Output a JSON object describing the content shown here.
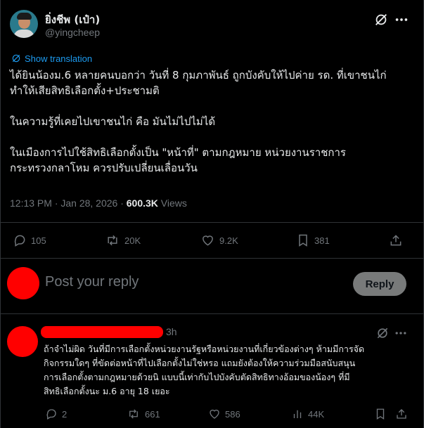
{
  "post": {
    "display_name": "ยิ่งชีพ (เป๋า)",
    "handle": "@yingcheep",
    "translate_label": "Show translation",
    "text_lines": [
      "ได้ยินน้องม.6 หลายคนบอกว่า วันที่ 8 กุมภาพันธ์ ถูกบังคับให้ไปค่าย รด. ที่เขาชนไก่",
      "ทำให้เสียสิทธิเลือกตั้ง+ประชามติ",
      "",
      "ในความรู้ที่เคยไปเขาชนไก่ คือ มันไม่ไปไม่ได้",
      "",
      "ในเมืองการไปใช้สิทธิเลือกตั้งเป็น \"หน้าที่\" ตามกฎหมาย หน่วยงานราชการ",
      "กระทรวงกลาโหม ควรปรับเปลี่ยนเลื่อนวัน"
    ],
    "timestamp": "12:13 PM · Jan 28, 2026 · ",
    "views_count": "600.3K",
    "views_label": " Views",
    "actions": {
      "replies": "105",
      "reposts": "20K",
      "likes": "9.2K",
      "bookmarks": "381"
    }
  },
  "reply_box": {
    "placeholder": "Post your reply",
    "button_label": "Reply"
  },
  "comment": {
    "time": "3h",
    "text_lines": [
      "ถ้าจำไม่ผิด วันที่มีการเลือกตั้งหน่วยงานรัฐหรือหน่วยงานที่เกี่ยวข้องต่างๆ ห้ามมีการจัด",
      "กิจกรรมใดๆ ที่ขัดต่อหน้าที่ไปเลือกตั้งไม่ใช่หรอ แถมยังต้องให้ความร่วมมือสนับสนุน",
      "การเลือกตั้งตามกฎหมายด้วยนิ แบบนี้เท่ากับไปบังคับตัดสิทธิทางอ้อมของน้องๆ ที่มี",
      "สิทธิเลือกตั้งนะ ม.6 อายุ 18 เยอะ"
    ],
    "actions": {
      "replies": "2",
      "reposts": "661",
      "likes": "586",
      "views": "44K"
    }
  }
}
